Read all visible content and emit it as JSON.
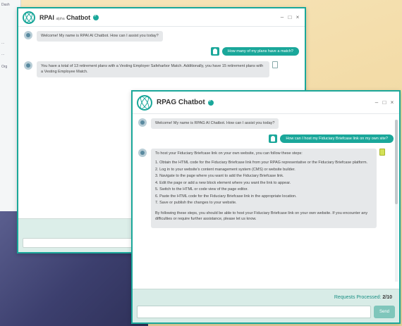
{
  "bg_app": {
    "lines": [
      "Dash",
      "...",
      "...",
      "Org"
    ]
  },
  "window_back": {
    "title": "RPAI",
    "title_suffix": "alpha",
    "title_name": "Chatbot",
    "controls": [
      "–",
      "□",
      "×"
    ],
    "messages": [
      {
        "role": "bot",
        "text": "Welcome! My name is RPAI AI Chatbot. How can I assist you today?"
      },
      {
        "role": "user",
        "text": "How many of my plans have a match?"
      },
      {
        "role": "bot",
        "text": "You have a total of 13 retirement plans with a Vesting Employer Safeharbor Match. Additionally, you have 15 retirement plans with a Vesting Employee Match."
      }
    ]
  },
  "window_front": {
    "title": "RPAG Chatbot",
    "controls": [
      "–",
      "□",
      "×"
    ],
    "messages": [
      {
        "role": "bot",
        "text": "Welcome! My name is RPAG AI Chatbot. How can I assist you today?"
      },
      {
        "role": "user",
        "text": "How can I host my Fiduciary Briefcase link on my own site?"
      }
    ],
    "answer": {
      "intro": "To host your Fiduciary Briefcase link on your own website, you can follow these steps:",
      "steps": [
        "1. Obtain the HTML code for the Fiduciary Briefcase link from your RPAG representative or the Fiduciary Briefcase platform.",
        "2. Log in to your website's content management system (CMS) or website builder.",
        "3. Navigate to the page where you want to add the Fiduciary Briefcase link.",
        "4. Edit the page or add a new block element where you want the link to appear.",
        "5. Switch to the HTML or code view of the page editor.",
        "6. Paste the HTML code for the Fiduciary Briefcase link in the appropriate location.",
        "7. Save or publish the changes to your website."
      ],
      "outro": "By following these steps, you should be able to host your Fiduciary Briefcase link on your own website. If you encounter any difficulties or require further assistance, please let us know."
    },
    "footer": {
      "requests_label": "Requests Processed:",
      "requests_value": "2/10",
      "send_label": "Send"
    }
  }
}
